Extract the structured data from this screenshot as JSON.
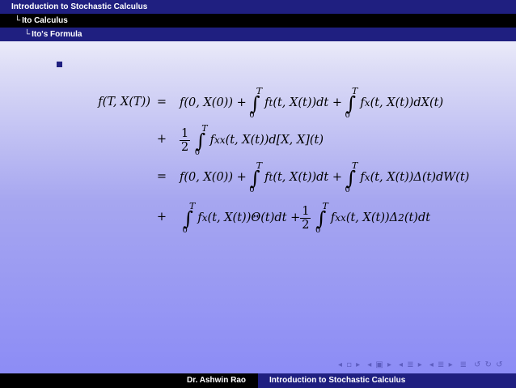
{
  "header": {
    "section": "Introduction to Stochastic Calculus",
    "subsection": "Ito Calculus",
    "subsubsection": "Ito's Formula"
  },
  "equations": [
    {
      "lhs": "f(T, X(T))",
      "op": "=",
      "rhs_a": "f(0, X(0)) +",
      "int1": {
        "upper": "T",
        "lower": "0"
      },
      "rhs_b": "f",
      "rhs_b_sub": "t",
      "rhs_c": "(t, X(t))dt +",
      "int2": {
        "upper": "T",
        "lower": "0"
      },
      "rhs_d": "f",
      "rhs_d_sub": "x",
      "rhs_e": "(t, X(t))dX(t)"
    },
    {
      "op": "+",
      "frac_num": "1",
      "frac_den": "2",
      "int1": {
        "upper": "T",
        "lower": "0"
      },
      "rhs_a": "f",
      "rhs_a_sub": "xx",
      "rhs_b": "(t, X(t))d[X, X](t)"
    },
    {
      "op": "=",
      "rhs_a": "f(0, X(0)) +",
      "int1": {
        "upper": "T",
        "lower": "0"
      },
      "rhs_b": "f",
      "rhs_b_sub": "t",
      "rhs_c": "(t, X(t))dt +",
      "int2": {
        "upper": "T",
        "lower": "0"
      },
      "rhs_d": "f",
      "rhs_d_sub": "x",
      "rhs_e": "(t, X(t))Δ(t)dW(t)"
    },
    {
      "op": "+",
      "int1": {
        "upper": "T",
        "lower": "0"
      },
      "rhs_a": "f",
      "rhs_a_sub": "x",
      "rhs_b": "(t, X(t))Θ(t)dt +",
      "frac_num": "1",
      "frac_den": "2",
      "int2": {
        "upper": "T",
        "lower": "0"
      },
      "rhs_c": "f",
      "rhs_c_sub": "xx",
      "rhs_d": "(t, X(t))Δ",
      "rhs_d_sup": "2",
      "rhs_e": "(t)dt"
    }
  ],
  "integral_symbol": "∫",
  "tree_glyph": "└",
  "nav": [
    "◂ ▫ ▸",
    "◂ ▣ ▸",
    "◂ ≣ ▸",
    "◂ ≣ ▸",
    "≣",
    "↺ ↻ ↺"
  ],
  "footer": {
    "author": "Dr. Ashwin Rao",
    "title": "Introduction to Stochastic Calculus"
  },
  "colors": {
    "header_blue": "#1f1f80",
    "header_black": "#000000",
    "bullet": "#1f1f80"
  }
}
